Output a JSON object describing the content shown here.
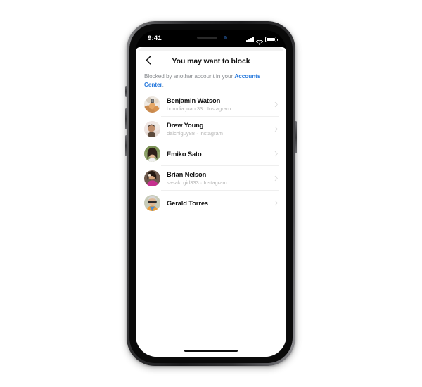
{
  "device": {
    "type": "smartphone",
    "frame_color": "#2b2b2d"
  },
  "status_bar": {
    "time": "9:41",
    "icons": [
      "cellular-signal-icon",
      "wifi-icon",
      "battery-icon"
    ]
  },
  "nav": {
    "back_icon": "chevron-left-icon",
    "title": "You may want to block"
  },
  "subtitle": {
    "text_before": "Blocked by another account in your ",
    "link_text": "Accounts Center",
    "text_after": ".",
    "link_color": "#2a7bdd",
    "text_color": "#8a8d91"
  },
  "list": {
    "items": [
      {
        "name": "Benjamin Watson",
        "handle": "bomdia.joao.33 · Instagram",
        "avatar": "photo-person-1",
        "chevron": "chevron-right-icon"
      },
      {
        "name": "Drew Young",
        "handle": "daichiguy88 · Instagram",
        "avatar": "photo-person-2",
        "chevron": "chevron-right-icon"
      },
      {
        "name": "Emiko Sato",
        "handle": "",
        "avatar": "photo-person-3",
        "chevron": "chevron-right-icon"
      },
      {
        "name": "Brian Nelson",
        "handle": "sasaki.girl333 · Instagram",
        "avatar": "photo-person-4",
        "chevron": "chevron-right-icon"
      },
      {
        "name": "Gerald Torres",
        "handle": "",
        "avatar": "photo-person-5",
        "chevron": "chevron-right-icon"
      }
    ]
  },
  "home_indicator": {
    "present": true
  }
}
